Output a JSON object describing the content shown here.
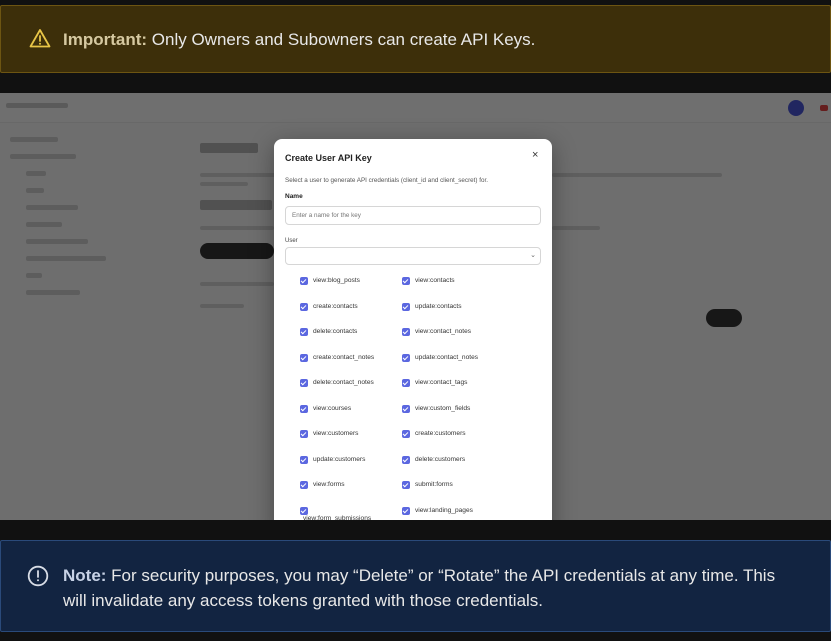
{
  "warning": {
    "icon": "warning-triangle-icon",
    "bold": "Important:",
    "text": " Only Owners and Subowners can create API Keys."
  },
  "note": {
    "icon": "info-circle-icon",
    "bold": "Note:",
    "text": " For security purposes, you may “Delete” or “Rotate” the API credentials at any time. This will invalidate any access tokens granted with those credentials."
  },
  "modal": {
    "title": "Create User API Key",
    "close": "×",
    "description": "Select a user to generate API credentials (client_id and client_secret) for.",
    "name_label": "Name",
    "name_placeholder": "Enter a name for the key",
    "user_label": "User",
    "user_value": "",
    "permissions_left": [
      "view:blog_posts",
      "create:contacts",
      "delete:contacts",
      "create:contact_notes",
      "delete:contact_notes",
      "view:courses",
      "view:customers",
      "update:customers",
      "view:forms",
      "view:form_submissions"
    ],
    "permissions_right": [
      "view:contacts",
      "update:contacts",
      "view:contact_notes",
      "update:contact_notes",
      "view:contact_tags",
      "view:custom_fields",
      "create:customers",
      "delete:customers",
      "submit:forms",
      "view:landing_pages"
    ]
  },
  "colors": {
    "accent": "#5b67e0",
    "warning_bg": "#3d2f0a",
    "note_bg": "#122441"
  }
}
